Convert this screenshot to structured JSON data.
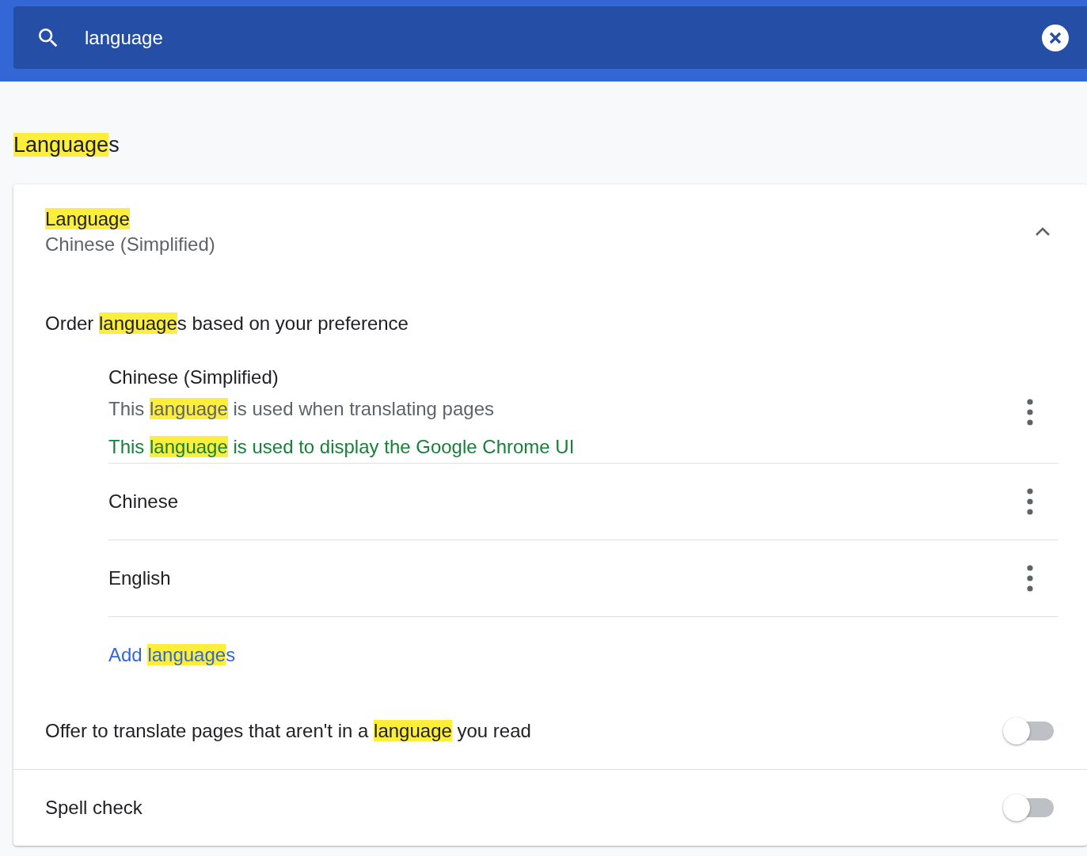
{
  "search": {
    "value": "language"
  },
  "section_title": [
    {
      "text": "Language",
      "highlighted": true
    },
    {
      "text": "s",
      "highlighted": false
    }
  ],
  "card": {
    "language": {
      "title": [
        {
          "text": "Language",
          "highlighted": true
        }
      ],
      "value": "Chinese (Simplified)",
      "expanded": true
    },
    "order_label": [
      {
        "text": "Order ",
        "highlighted": false
      },
      {
        "text": "language",
        "highlighted": true
      },
      {
        "text": "s based on your preference",
        "highlighted": false
      }
    ],
    "languages": [
      {
        "name": "Chinese (Simplified)",
        "notes": [
          {
            "kind": "info",
            "text": [
              {
                "text": "This ",
                "highlighted": false
              },
              {
                "text": "language",
                "highlighted": true
              },
              {
                "text": " is used when translating pages",
                "highlighted": false
              }
            ]
          },
          {
            "kind": "ui",
            "text": [
              {
                "text": "This ",
                "highlighted": false
              },
              {
                "text": "language",
                "highlighted": true
              },
              {
                "text": " is used to display the Google Chrome UI",
                "highlighted": false
              }
            ]
          }
        ]
      },
      {
        "name": "Chinese"
      },
      {
        "name": "English"
      }
    ],
    "add_link": [
      {
        "text": "Add ",
        "highlighted": false
      },
      {
        "text": "language",
        "highlighted": true
      },
      {
        "text": "s",
        "highlighted": false
      }
    ],
    "settings": [
      {
        "label": [
          {
            "text": "Offer to translate pages that aren't in a ",
            "highlighted": false
          },
          {
            "text": "language",
            "highlighted": true
          },
          {
            "text": " you read",
            "highlighted": false
          }
        ],
        "on": false
      },
      {
        "label": [
          {
            "text": "Spell check",
            "highlighted": false
          }
        ],
        "on": false
      }
    ]
  }
}
